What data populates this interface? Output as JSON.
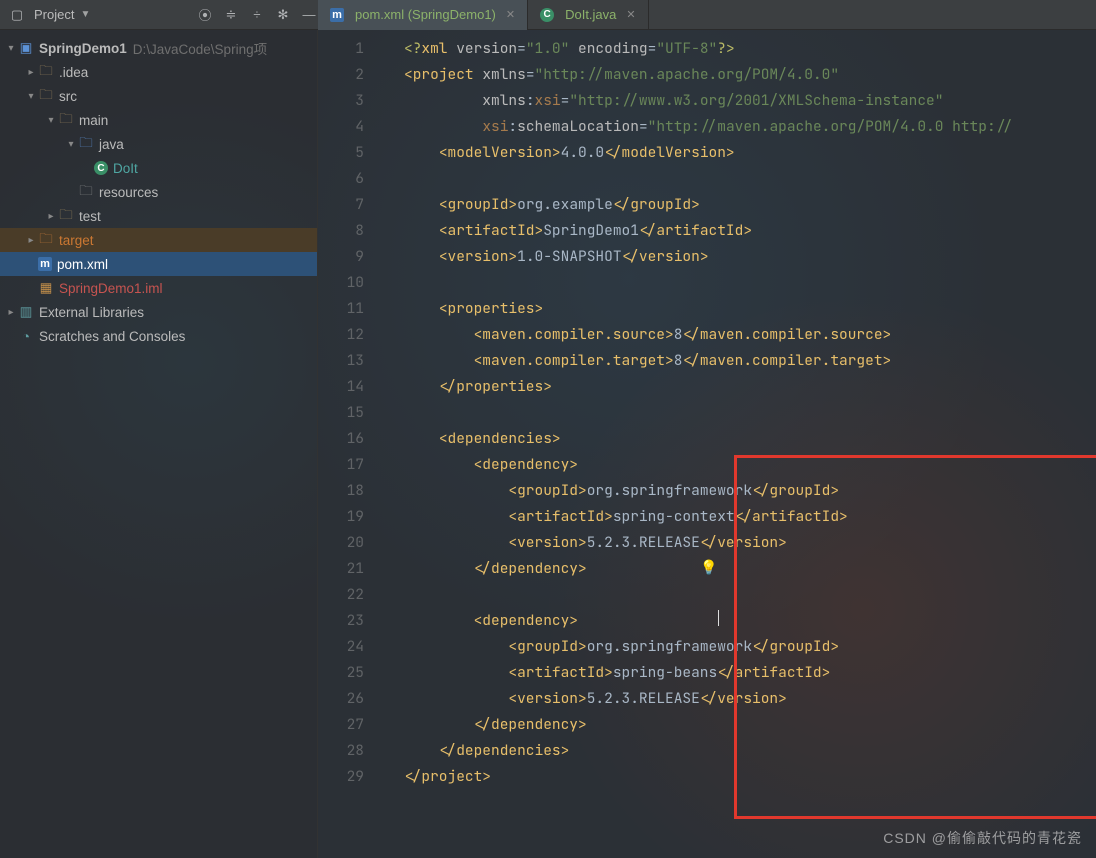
{
  "toolbar": {
    "project_label": "Project"
  },
  "tabs": [
    {
      "label": "pom.xml (SpringDemo1)",
      "icon": "m",
      "active": true
    },
    {
      "label": "DoIt.java",
      "icon": "c",
      "active": false
    }
  ],
  "project_tree": {
    "root_name": "SpringDemo1",
    "root_path": "D:\\JavaCode\\Spring项",
    "idea": ".idea",
    "src": "src",
    "main": "main",
    "java": "java",
    "doit": "DoIt",
    "resources": "resources",
    "test": "test",
    "target": "target",
    "pom": "pom.xml",
    "iml": "SpringDemo1.iml",
    "ext_lib": "External Libraries",
    "scratches": "Scratches and Consoles"
  },
  "code_lines": [
    {
      "n": "1",
      "seg": [
        [
          "t-pi",
          "<?"
        ],
        [
          "t-decl",
          "xml "
        ],
        [
          "t-attr",
          "version"
        ],
        [
          "t-txt",
          "="
        ],
        [
          "t-str",
          "\"1.0\" "
        ],
        [
          "t-attr",
          "encoding"
        ],
        [
          "t-txt",
          "="
        ],
        [
          "t-str",
          "\"UTF-8\""
        ],
        [
          "t-pi",
          "?>"
        ]
      ],
      "ind": 0
    },
    {
      "n": "2",
      "seg": [
        [
          "t-decl",
          "<project "
        ],
        [
          "t-attr",
          "xmlns"
        ],
        [
          "t-txt",
          "="
        ],
        [
          "t-str",
          "\"http://maven.apache.org/POM/4.0.0\""
        ]
      ],
      "ind": 0
    },
    {
      "n": "3",
      "seg": [
        [
          "t-attr",
          "         xmlns"
        ],
        [
          "t-txt",
          ":"
        ],
        [
          "t-ns",
          "xsi"
        ],
        [
          "t-txt",
          "="
        ],
        [
          "t-str",
          "\"http://www.w3.org/2001/XMLSchema-instance\""
        ]
      ],
      "ind": 0
    },
    {
      "n": "4",
      "seg": [
        [
          "t-txt",
          "         "
        ],
        [
          "t-ns",
          "xsi"
        ],
        [
          "t-txt",
          ":"
        ],
        [
          "t-attr",
          "schemaLocation"
        ],
        [
          "t-txt",
          "="
        ],
        [
          "t-str",
          "\"http://maven.apache.org/POM/4.0.0 http://"
        ]
      ],
      "ind": 0
    },
    {
      "n": "5",
      "seg": [
        [
          "t-decl",
          "<modelVersion>"
        ],
        [
          "t-txt",
          "4.0.0"
        ],
        [
          "t-decl",
          "</modelVersion>"
        ]
      ],
      "ind": 1
    },
    {
      "n": "6",
      "seg": [],
      "ind": 0
    },
    {
      "n": "7",
      "seg": [
        [
          "t-decl",
          "<groupId>"
        ],
        [
          "t-txt",
          "org.example"
        ],
        [
          "t-decl",
          "</groupId>"
        ]
      ],
      "ind": 1
    },
    {
      "n": "8",
      "seg": [
        [
          "t-decl",
          "<artifactId>"
        ],
        [
          "t-txt",
          "SpringDemo1"
        ],
        [
          "t-decl",
          "</artifactId>"
        ]
      ],
      "ind": 1
    },
    {
      "n": "9",
      "seg": [
        [
          "t-decl",
          "<version>"
        ],
        [
          "t-txt",
          "1.0-SNAPSHOT"
        ],
        [
          "t-decl",
          "</version>"
        ]
      ],
      "ind": 1
    },
    {
      "n": "10",
      "seg": [],
      "ind": 0
    },
    {
      "n": "11",
      "seg": [
        [
          "t-decl",
          "<properties>"
        ]
      ],
      "ind": 1
    },
    {
      "n": "12",
      "seg": [
        [
          "t-decl",
          "<maven.compiler.source>"
        ],
        [
          "t-txt",
          "8"
        ],
        [
          "t-decl",
          "</maven.compiler.source>"
        ]
      ],
      "ind": 2
    },
    {
      "n": "13",
      "seg": [
        [
          "t-decl",
          "<maven.compiler.target>"
        ],
        [
          "t-txt",
          "8"
        ],
        [
          "t-decl",
          "</maven.compiler.target>"
        ]
      ],
      "ind": 2
    },
    {
      "n": "14",
      "seg": [
        [
          "t-decl",
          "</properties>"
        ]
      ],
      "ind": 1
    },
    {
      "n": "15",
      "seg": [],
      "ind": 0
    },
    {
      "n": "16",
      "seg": [
        [
          "t-decl",
          "<dependencies>"
        ]
      ],
      "ind": 1
    },
    {
      "n": "17",
      "seg": [
        [
          "t-decl",
          "<dependency>"
        ]
      ],
      "ind": 2
    },
    {
      "n": "18",
      "seg": [
        [
          "t-decl",
          "<groupId>"
        ],
        [
          "t-txt",
          "org.springframework"
        ],
        [
          "t-decl",
          "</groupId>"
        ]
      ],
      "ind": 3
    },
    {
      "n": "19",
      "seg": [
        [
          "t-decl",
          "<artifactId>"
        ],
        [
          "t-txt",
          "spring-context"
        ],
        [
          "t-decl",
          "</artifactId>"
        ]
      ],
      "ind": 3
    },
    {
      "n": "20",
      "seg": [
        [
          "t-decl",
          "<version>"
        ],
        [
          "t-txt",
          "5.2.3.RELEASE"
        ],
        [
          "t-decl",
          "</version>"
        ]
      ],
      "ind": 3
    },
    {
      "n": "21",
      "seg": [
        [
          "t-decl",
          "</dependency>"
        ]
      ],
      "ind": 2
    },
    {
      "n": "22",
      "seg": [],
      "ind": 0
    },
    {
      "n": "23",
      "seg": [
        [
          "t-decl",
          "<dependency>"
        ]
      ],
      "ind": 2
    },
    {
      "n": "24",
      "seg": [
        [
          "t-decl",
          "<groupId>"
        ],
        [
          "t-txt",
          "org.springframework"
        ],
        [
          "t-decl",
          "</groupId>"
        ]
      ],
      "ind": 3
    },
    {
      "n": "25",
      "seg": [
        [
          "t-decl",
          "<artifactId>"
        ],
        [
          "t-txt",
          "spring-beans"
        ],
        [
          "t-decl",
          "</artifactId>"
        ]
      ],
      "ind": 3
    },
    {
      "n": "26",
      "seg": [
        [
          "t-decl",
          "<version>"
        ],
        [
          "t-txt",
          "5.2.3.RELEASE"
        ],
        [
          "t-decl",
          "</version>"
        ]
      ],
      "ind": 3
    },
    {
      "n": "27",
      "seg": [
        [
          "t-decl",
          "</dependency>"
        ]
      ],
      "ind": 2
    },
    {
      "n": "28",
      "seg": [
        [
          "t-decl",
          "</dependencies>"
        ]
      ],
      "ind": 1
    },
    {
      "n": "29",
      "seg": [
        [
          "t-decl",
          "</project>"
        ]
      ],
      "ind": 0
    }
  ],
  "watermark": "CSDN @偷偷敲代码的青花瓷"
}
